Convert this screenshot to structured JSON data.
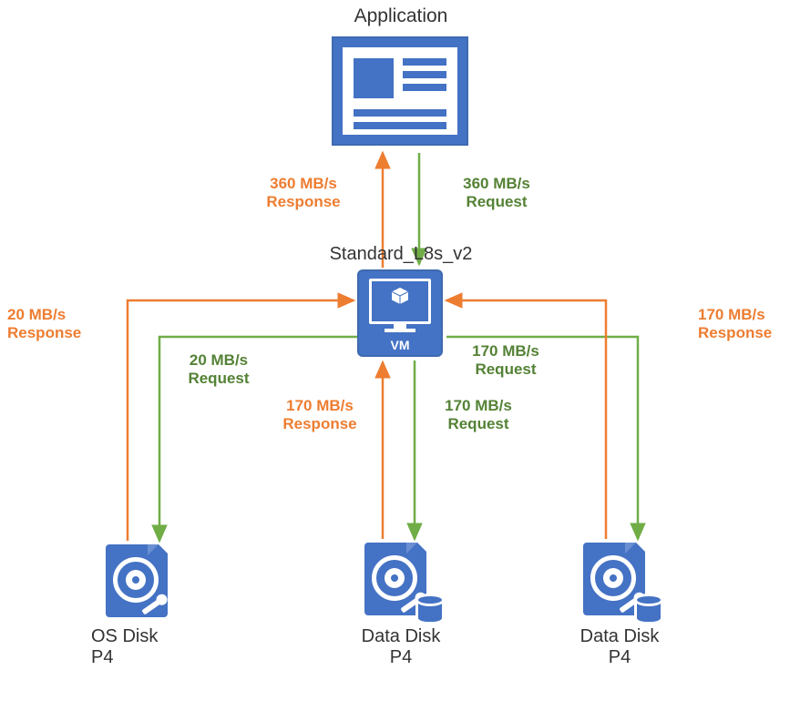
{
  "title_application": "Application",
  "title_vm": "Standard_L8s_v2",
  "vm_badge": "VM",
  "disks": {
    "os": {
      "label_line1": "OS Disk",
      "label_line2": "P4"
    },
    "data1": {
      "label_line1": "Data Disk",
      "label_line2": "P4"
    },
    "data2": {
      "label_line1": "Data Disk",
      "label_line2": "P4"
    }
  },
  "flows": {
    "app_response": {
      "line1": "360 MB/s",
      "line2": "Response"
    },
    "app_request": {
      "line1": "360 MB/s",
      "line2": "Request"
    },
    "os_response": {
      "line1": "20 MB/s",
      "line2": "Response"
    },
    "os_request": {
      "line1": "20 MB/s",
      "line2": "Request"
    },
    "data1_response": {
      "line1": "170 MB/s",
      "line2": "Response"
    },
    "data1_request": {
      "line1": "170 MB/s",
      "line2": "Request"
    },
    "data2_response": {
      "line1": "170 MB/s",
      "line2": "Response"
    },
    "data2_request": {
      "line1": "170 MB/s",
      "line2": "Request"
    }
  },
  "colors": {
    "primary": "#4472C4",
    "green": "#70AD47",
    "orange": "#ED7D31"
  }
}
